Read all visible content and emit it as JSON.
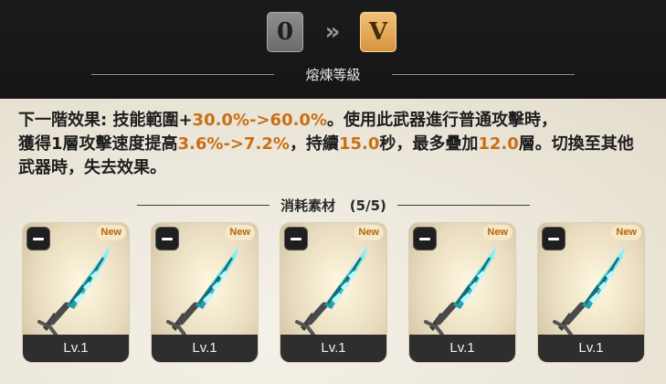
{
  "header": {
    "rank_from": "0",
    "rank_to": "V",
    "arrows": "»",
    "section_title": "熔煉等級"
  },
  "description": {
    "prefix1": "下一階效果: 技能範圍+",
    "range": "30.0%->60.0%",
    "mid1": "。使用此武器進行普通攻擊時，",
    "prefix2": "獲得1層攻擊速度提高",
    "speed": "3.6%->7.2%",
    "mid2": "，持續",
    "duration": "15.0",
    "mid3": "秒，最多疊加",
    "stacks": "12.0",
    "suffix": "層。切換至其他武器時，失去效果。"
  },
  "materials": {
    "title": "消耗素材",
    "count": "(5/5)",
    "items": [
      {
        "level": "Lv.1",
        "badge": "New"
      },
      {
        "level": "Lv.1",
        "badge": "New"
      },
      {
        "level": "Lv.1",
        "badge": "New"
      },
      {
        "level": "Lv.1",
        "badge": "New"
      },
      {
        "level": "Lv.1",
        "badge": "New"
      }
    ]
  },
  "colors": {
    "highlight": "#c96f16",
    "rank_from": "#7a7a7a",
    "rank_to": "#e4a652",
    "spear_blade": "#2ec9d8"
  }
}
